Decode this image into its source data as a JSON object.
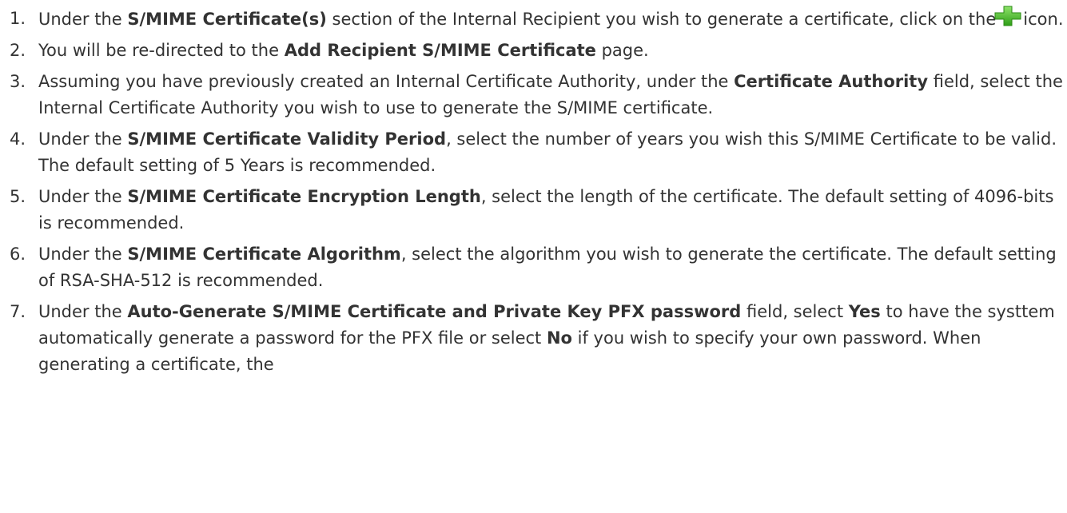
{
  "steps": [
    {
      "number": "1.",
      "parts": [
        "Under the ",
        "S/MIME Certificate(s)",
        " section of the Internal Recipient you wish to generate a certificate, click on the",
        "icon."
      ],
      "icon": "green-plus-icon"
    },
    {
      "number": "2.",
      "parts": [
        "You will be re-directed to the ",
        "Add Recipient S/MIME Certificate",
        " page."
      ]
    },
    {
      "number": "3.",
      "parts": [
        "Assuming you have previously created an Internal Certificate Authority, under the ",
        "Certificate Authority",
        " field, select the Internal Certificate Authority you wish to use to generate the S/MIME certificate."
      ]
    },
    {
      "number": "4.",
      "parts": [
        "Under the ",
        "S/MIME Certificate Validity Period",
        ", select the number of years you wish this S/MIME Certificate to be valid. The default setting of 5 Years is recommended."
      ]
    },
    {
      "number": "5.",
      "parts": [
        "Under the ",
        "S/MIME Certificate Encryption Length",
        ", select the length of the certificate. The default setting of 4096-bits is recommended."
      ]
    },
    {
      "number": "6.",
      "parts": [
        "Under the ",
        "S/MIME Certificate Algorithm",
        ", select the algorithm you wish to generate the certificate. The default setting of RSA-SHA-512 is recommended."
      ]
    },
    {
      "number": "7.",
      "parts": [
        "Under the ",
        "Auto-Generate S/MIME Certificate and Private Key PFX password",
        " field, select ",
        "Yes",
        " to have the systtem automatically generate a password for the PFX file or select ",
        "No",
        " if you wish to specify your own password. When generating a certificate, the"
      ]
    }
  ],
  "colors": {
    "text": "#333333",
    "icon_green": "#3cb521"
  }
}
